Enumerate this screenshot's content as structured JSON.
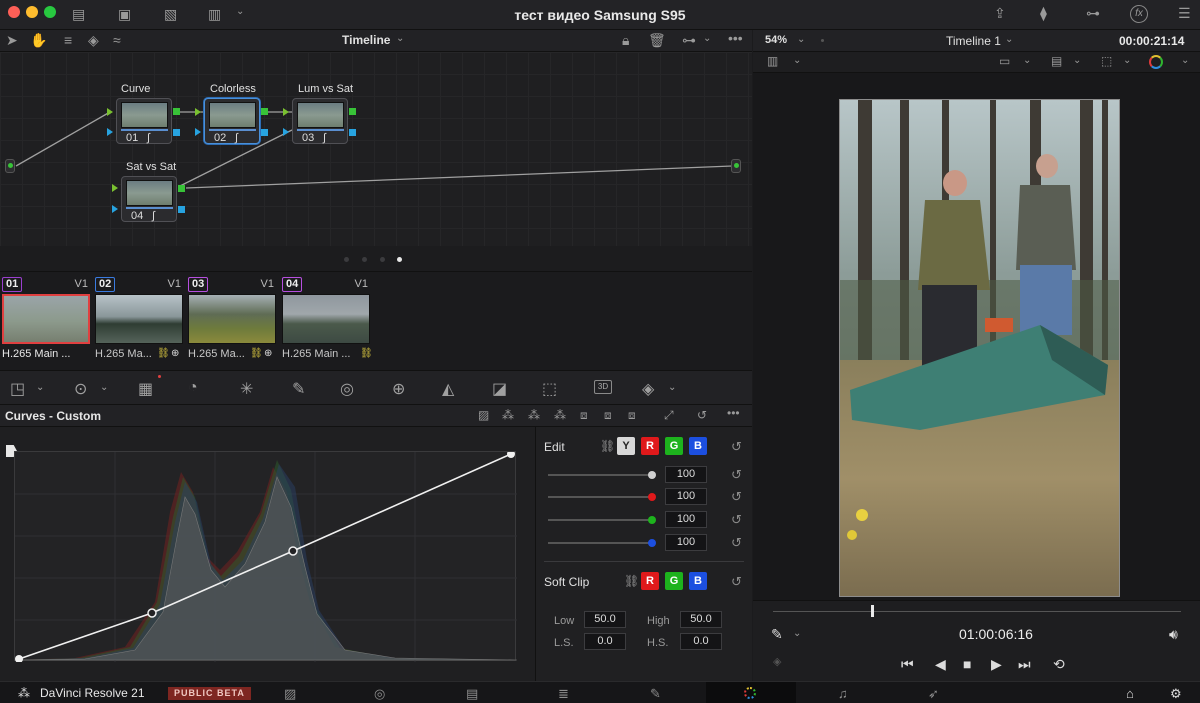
{
  "window": {
    "title": "тест видео Samsung S95"
  },
  "node_editor": {
    "mode_label": "Timeline",
    "nodes": [
      {
        "label": "Curve",
        "num": "01"
      },
      {
        "label": "Colorless",
        "num": "02"
      },
      {
        "label": "Lum vs Sat",
        "num": "03"
      },
      {
        "label": "Sat vs Sat",
        "num": "04"
      }
    ]
  },
  "clips": [
    {
      "num": "01",
      "track": "V1",
      "name": "H.265 Main ...",
      "color": "#9b3fd0"
    },
    {
      "num": "02",
      "track": "V1",
      "name": "H.265 Ma...",
      "color": "#3a7be0"
    },
    {
      "num": "03",
      "track": "V1",
      "name": "H.265 Ma...",
      "color": "#b74fe0"
    },
    {
      "num": "04",
      "track": "V1",
      "name": "H.265 Main ...",
      "color": "#b74fe0"
    }
  ],
  "curves": {
    "title": "Curves - Custom",
    "edit_label": "Edit",
    "channels": [
      "Y",
      "R",
      "G",
      "B"
    ],
    "intensity": [
      {
        "channel": "Y",
        "value": "100",
        "color": "#d0d0d0"
      },
      {
        "channel": "R",
        "value": "100",
        "color": "#e0191b"
      },
      {
        "channel": "G",
        "value": "100",
        "color": "#1db31d"
      },
      {
        "channel": "B",
        "value": "100",
        "color": "#1c4fe0"
      }
    ],
    "soft_clip": {
      "label": "Soft Clip",
      "low_label": "Low",
      "low": "50.0",
      "high_label": "High",
      "high": "50.0",
      "ls_label": "L.S.",
      "ls": "0.0",
      "hs_label": "H.S.",
      "hs": "0.0"
    }
  },
  "viewer": {
    "zoom": "54%",
    "timeline_name": "Timeline 1",
    "duration": "00:00:21:14",
    "timecode": "01:00:06:16"
  },
  "app": {
    "name": "DaVinci Resolve 21",
    "badge": "PUBLIC BETA"
  }
}
